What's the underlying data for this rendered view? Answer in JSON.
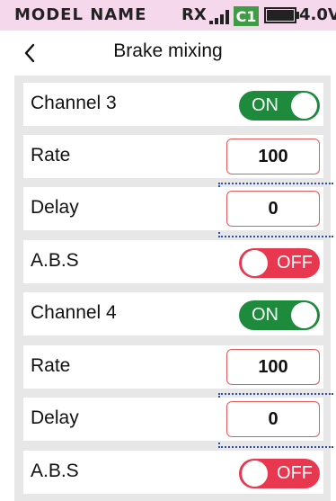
{
  "status_bar": {
    "model_name": "MODEL NAME",
    "rx_label": "RX",
    "channel_badge": "C1",
    "voltage": "4.0V",
    "battery_level": 0.95,
    "signal_bars": 4,
    "colors": {
      "background": "#f5d8ec",
      "badge": "#3f9b45"
    }
  },
  "header": {
    "back_icon": "chevron-left-icon",
    "title": "Brake mixing"
  },
  "rows": [
    {
      "label": "Channel 3",
      "type": "toggle",
      "value": "ON"
    },
    {
      "label": "Rate",
      "type": "value",
      "value": "100"
    },
    {
      "label": "Delay",
      "type": "value",
      "value": "0"
    },
    {
      "label": "A.B.S",
      "type": "toggle",
      "value": "OFF"
    },
    {
      "label": "Channel 4",
      "type": "toggle",
      "value": "ON"
    },
    {
      "label": "Rate",
      "type": "value",
      "value": "100"
    },
    {
      "label": "Delay",
      "type": "value",
      "value": "0"
    },
    {
      "label": "A.B.S",
      "type": "toggle",
      "value": "OFF"
    }
  ],
  "colors": {
    "toggle_on": "#1e8a3c",
    "toggle_off": "#e8384f",
    "value_border": "#e35b5b",
    "panel": "#e7e7e7"
  }
}
